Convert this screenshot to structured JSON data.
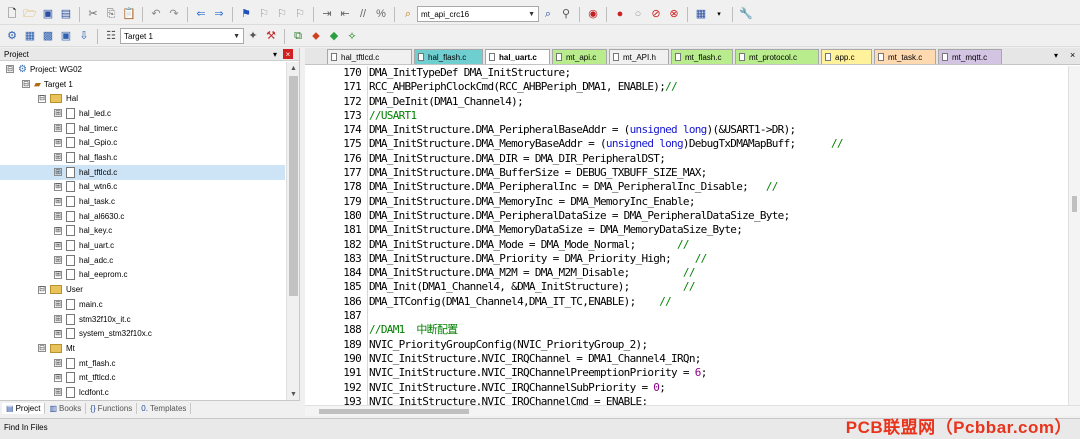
{
  "toolbar1": {
    "file_combo_value": "mt_api_crc16",
    "icons": [
      "new-file-icon",
      "open-folder-icon",
      "save-icon",
      "save-all-icon",
      "cut-icon",
      "copy-icon",
      "paste-icon",
      "undo-icon",
      "redo-icon",
      "nav-back-icon",
      "nav-forward-icon",
      "bookmark-icon",
      "bookmark-prev-icon",
      "bookmark-next-icon",
      "bookmark-clear-icon",
      "indent-icon",
      "unindent-icon",
      "comment-icon",
      "uncomment-icon",
      "find-in-files-icon",
      "debug-start-icon",
      "breakpoint-icon",
      "breakpoint-disable-icon",
      "breakpoint-kill-icon",
      "breakpoint-clear-icon",
      "window-layout-icon",
      "configure-icon"
    ]
  },
  "toolbar2": {
    "target_value": "Target 1",
    "icons": [
      "translate-icon",
      "build-icon",
      "rebuild-icon",
      "batch-build-icon",
      "download-icon",
      "target-options-icon",
      "magic-wand-icon",
      "manage-components-icon",
      "rte-icon",
      "pack-installer-icon",
      "green-diamond-icon"
    ]
  },
  "project_panel": {
    "title": "Project",
    "pin": "▾",
    "close": "×",
    "tree": [
      {
        "depth": 0,
        "kind": "project",
        "expander": "⊟",
        "label": "Project: WG02"
      },
      {
        "depth": 1,
        "kind": "target",
        "expander": "⊟",
        "label": "Target 1"
      },
      {
        "depth": 2,
        "kind": "folder",
        "expander": "⊟",
        "label": "Hal"
      },
      {
        "depth": 3,
        "kind": "file",
        "expander": "⊞",
        "label": "hal_led.c"
      },
      {
        "depth": 3,
        "kind": "file",
        "expander": "⊞",
        "label": "hal_timer.c"
      },
      {
        "depth": 3,
        "kind": "file",
        "expander": "⊞",
        "label": "hal_Gpio.c"
      },
      {
        "depth": 3,
        "kind": "file",
        "expander": "⊞",
        "label": "hal_flash.c"
      },
      {
        "depth": 3,
        "kind": "file",
        "expander": "⊞",
        "label": "hal_tftlcd.c",
        "selected": true
      },
      {
        "depth": 3,
        "kind": "file",
        "expander": "⊞",
        "label": "hal_wtn6.c"
      },
      {
        "depth": 3,
        "kind": "file",
        "expander": "⊞",
        "label": "hal_task.c"
      },
      {
        "depth": 3,
        "kind": "file",
        "expander": "⊞",
        "label": "hal_al6630.c"
      },
      {
        "depth": 3,
        "kind": "file",
        "expander": "⊞",
        "label": "hal_key.c"
      },
      {
        "depth": 3,
        "kind": "file",
        "expander": "⊞",
        "label": "hal_uart.c"
      },
      {
        "depth": 3,
        "kind": "file",
        "expander": "⊞",
        "label": "hal_adc.c"
      },
      {
        "depth": 3,
        "kind": "file",
        "expander": "⊞",
        "label": "hal_eeprom.c"
      },
      {
        "depth": 2,
        "kind": "folder",
        "expander": "⊟",
        "label": "User"
      },
      {
        "depth": 3,
        "kind": "file",
        "expander": "⊞",
        "label": "main.c"
      },
      {
        "depth": 3,
        "kind": "file",
        "expander": "⊞",
        "label": "stm32f10x_it.c"
      },
      {
        "depth": 3,
        "kind": "file",
        "expander": "⊞",
        "label": "system_stm32f10x.c"
      },
      {
        "depth": 2,
        "kind": "folder",
        "expander": "⊟",
        "label": "Mt"
      },
      {
        "depth": 3,
        "kind": "file",
        "expander": "⊞",
        "label": "mt_flash.c"
      },
      {
        "depth": 3,
        "kind": "file",
        "expander": "⊞",
        "label": "mt_tftlcd.c"
      },
      {
        "depth": 3,
        "kind": "file",
        "expander": "⊞",
        "label": "lcdfont.c"
      }
    ],
    "bottom_tabs": [
      {
        "icon": "▤",
        "label": "Project",
        "active": true
      },
      {
        "icon": "▥",
        "label": "Books",
        "active": false
      },
      {
        "icon": "{}",
        "label": "Functions",
        "active": false
      },
      {
        "icon": "0.",
        "label": "Templates",
        "active": false
      }
    ]
  },
  "editor": {
    "tabs": [
      {
        "label": "hal_tftlcd.c",
        "color": "#f0f0f0",
        "active": false
      },
      {
        "label": "hal_flash.c",
        "color": "#6fcfd0",
        "active": false
      },
      {
        "label": "hal_uart.c",
        "color": "#ffffff",
        "active": true
      },
      {
        "label": "mt_api.c",
        "color": "#b8ec8c",
        "active": false
      },
      {
        "label": "mt_API.h",
        "color": "#f0f0f0",
        "active": false
      },
      {
        "label": "mt_flash.c",
        "color": "#b8ec8c",
        "active": false
      },
      {
        "label": "mt_protocol.c",
        "color": "#b8ec8c",
        "active": false
      },
      {
        "label": "app.c",
        "color": "#fff29a",
        "active": false
      },
      {
        "label": "mt_task.c",
        "color": "#ffd9b0",
        "active": false
      },
      {
        "label": "mt_mqtt.c",
        "color": "#d4c4e4",
        "active": false
      }
    ],
    "tab_menu": "▾",
    "tab_close": "×",
    "lines": [
      {
        "n": "170",
        "segs": [
          {
            "t": "DMA_InitTypeDef DMA_InitStructure;",
            "c": ""
          }
        ]
      },
      {
        "n": "171",
        "segs": [
          {
            "t": "RCC_AHBPeriphClockCmd(RCC_AHBPeriph_DMA1, ENABLE);",
            "c": ""
          },
          {
            "t": "//",
            "c": "cm"
          }
        ]
      },
      {
        "n": "172",
        "segs": [
          {
            "t": "DMA_DeInit(DMA1_Channel4);",
            "c": ""
          }
        ]
      },
      {
        "n": "173",
        "segs": [
          {
            "t": "//USART1",
            "c": "cm"
          }
        ]
      },
      {
        "n": "174",
        "segs": [
          {
            "t": "DMA_InitStructure.DMA_PeripheralBaseAddr = (",
            "c": ""
          },
          {
            "t": "unsigned long",
            "c": "kw"
          },
          {
            "t": ")(&USART1->DR);",
            "c": ""
          }
        ]
      },
      {
        "n": "175",
        "segs": [
          {
            "t": "DMA_InitStructure.DMA_MemoryBaseAddr = (",
            "c": ""
          },
          {
            "t": "unsigned long",
            "c": "kw"
          },
          {
            "t": ")DebugTxDMAMapBuff;      ",
            "c": ""
          },
          {
            "t": "//",
            "c": "cm"
          }
        ]
      },
      {
        "n": "176",
        "segs": [
          {
            "t": "DMA_InitStructure.DMA_DIR = DMA_DIR_PeripheralDST;",
            "c": ""
          }
        ]
      },
      {
        "n": "177",
        "segs": [
          {
            "t": "DMA_InitStructure.DMA_BufferSize = DEBUG_TXBUFF_SIZE_MAX;",
            "c": ""
          }
        ]
      },
      {
        "n": "178",
        "segs": [
          {
            "t": "DMA_InitStructure.DMA_PeripheralInc = DMA_PeripheralInc_Disable;   ",
            "c": ""
          },
          {
            "t": "//",
            "c": "cm"
          }
        ]
      },
      {
        "n": "179",
        "segs": [
          {
            "t": "DMA_InitStructure.DMA_MemoryInc = DMA_MemoryInc_Enable;",
            "c": ""
          }
        ]
      },
      {
        "n": "180",
        "segs": [
          {
            "t": "DMA_InitStructure.DMA_PeripheralDataSize = DMA_PeripheralDataSize_Byte;",
            "c": ""
          }
        ]
      },
      {
        "n": "181",
        "segs": [
          {
            "t": "DMA_InitStructure.DMA_MemoryDataSize = DMA_MemoryDataSize_Byte;",
            "c": ""
          }
        ]
      },
      {
        "n": "182",
        "segs": [
          {
            "t": "DMA_InitStructure.DMA_Mode = DMA_Mode_Normal;       ",
            "c": ""
          },
          {
            "t": "//",
            "c": "cm"
          }
        ]
      },
      {
        "n": "183",
        "segs": [
          {
            "t": "DMA_InitStructure.DMA_Priority = DMA_Priority_High;    ",
            "c": ""
          },
          {
            "t": "//",
            "c": "cm"
          }
        ]
      },
      {
        "n": "184",
        "segs": [
          {
            "t": "DMA_InitStructure.DMA_M2M = DMA_M2M_Disable;         ",
            "c": ""
          },
          {
            "t": "//",
            "c": "cm"
          }
        ]
      },
      {
        "n": "185",
        "segs": [
          {
            "t": "DMA_Init(DMA1_Channel4, &DMA_InitStructure);         ",
            "c": ""
          },
          {
            "t": "//",
            "c": "cm"
          }
        ]
      },
      {
        "n": "186",
        "segs": [
          {
            "t": "DMA_ITConfig(DMA1_Channel4,DMA_IT_TC,ENABLE);    ",
            "c": ""
          },
          {
            "t": "//",
            "c": "cm"
          }
        ]
      },
      {
        "n": "187",
        "segs": [
          {
            "t": "",
            "c": ""
          }
        ]
      },
      {
        "n": "188",
        "segs": [
          {
            "t": "//DAM1  中断配置",
            "c": "cm"
          }
        ]
      },
      {
        "n": "189",
        "segs": [
          {
            "t": "NVIC_PriorityGroupConfig(NVIC_PriorityGroup_2);",
            "c": ""
          }
        ]
      },
      {
        "n": "190",
        "segs": [
          {
            "t": "NVIC_InitStructure.NVIC_IRQChannel = DMA1_Channel4_IRQn;",
            "c": ""
          }
        ]
      },
      {
        "n": "191",
        "segs": [
          {
            "t": "NVIC_InitStructure.NVIC_IRQChannelPreemptionPriority = ",
            "c": ""
          },
          {
            "t": "6",
            "c": "nm"
          },
          {
            "t": ";",
            "c": ""
          }
        ]
      },
      {
        "n": "192",
        "segs": [
          {
            "t": "NVIC_InitStructure.NVIC_IRQChannelSubPriority = ",
            "c": ""
          },
          {
            "t": "0",
            "c": "nm"
          },
          {
            "t": ";",
            "c": ""
          }
        ]
      },
      {
        "n": "193",
        "segs": [
          {
            "t": "NVIC_InitStructure.NVIC_IRQChannelCmd = ENABLE;",
            "c": ""
          }
        ]
      }
    ]
  },
  "find_bar": {
    "label": "Find In Files"
  },
  "watermark": "PCB联盟网（Pcbbar.com）",
  "colors": {
    "keyword": "#1515d0",
    "comment": "#008000",
    "number": "#8b008b",
    "watermark": "#e8341c"
  }
}
